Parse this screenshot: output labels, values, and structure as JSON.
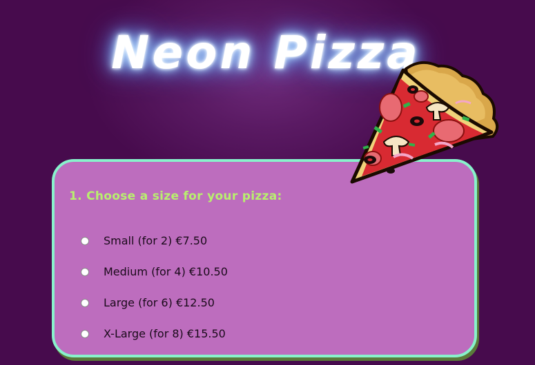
{
  "header": {
    "title": "Neon Pizza",
    "image_icon": "pizza-slice-icon"
  },
  "size_section": {
    "heading": "1. Choose a size for your pizza:",
    "options": [
      {
        "label": "Small (for 2) €7.50",
        "selected": false
      },
      {
        "label": "Medium (for 4) €10.50",
        "selected": false
      },
      {
        "label": "Large (for 6) €12.50",
        "selected": false
      },
      {
        "label": "X-Large (for 8) €15.50",
        "selected": false
      }
    ]
  },
  "colors": {
    "background": "#470b4d",
    "card": "#bd6dbe",
    "card_border": "#88f2cc",
    "heading": "#b8f06e"
  }
}
